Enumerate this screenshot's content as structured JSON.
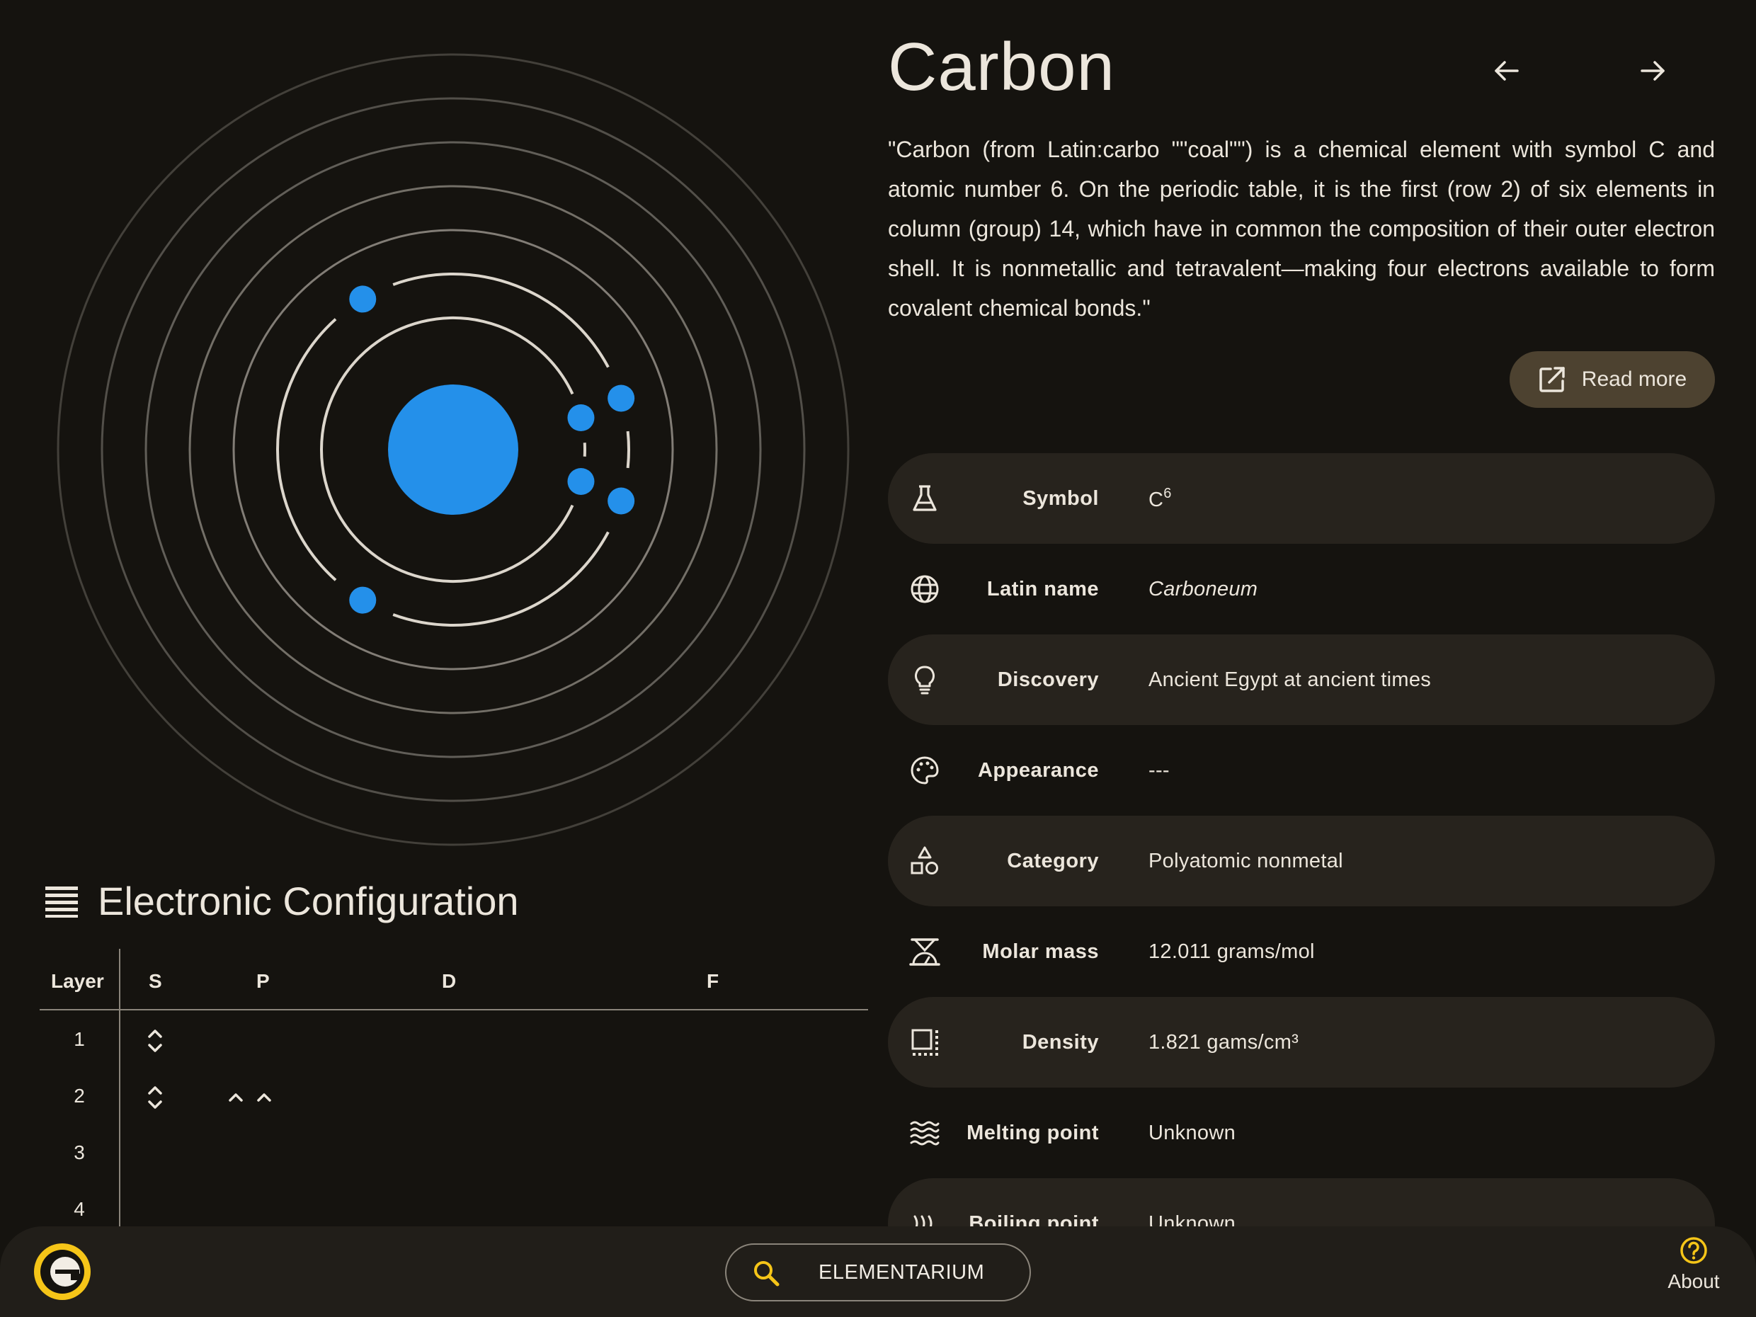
{
  "element": {
    "name": "Carbon",
    "description": "\"Carbon (from Latin:carbo \"\"coal\"\") is a chemical element with symbol C and atomic number 6. On the periodic table, it is the first (row 2) of six elements in column (group) 14, which have in common the composition of their outer electron shell. It is nonmetallic and tetravalent—making four electrons available to form covalent chemical bonds.\"",
    "read_more_label": "Read more"
  },
  "properties": [
    {
      "icon": "flask-icon",
      "label": "Symbol",
      "value": "C",
      "sup": "6",
      "shaded": true
    },
    {
      "icon": "globe-icon",
      "label": "Latin name",
      "value": "Carboneum",
      "italic": true,
      "shaded": false
    },
    {
      "icon": "lightbulb-icon",
      "label": "Discovery",
      "value": "Ancient Egypt at ancient times",
      "shaded": true
    },
    {
      "icon": "palette-icon",
      "label": "Appearance",
      "value": "---",
      "shaded": false
    },
    {
      "icon": "shapes-icon",
      "label": "Category",
      "value": "Polyatomic nonmetal",
      "shaded": true
    },
    {
      "icon": "scale-icon",
      "label": "Molar mass",
      "value": "12.011 grams/mol",
      "shaded": false
    },
    {
      "icon": "density-icon",
      "label": "Density",
      "value": "1.821 gams/cm³",
      "shaded": true
    },
    {
      "icon": "waves-icon",
      "label": "Melting point",
      "value": "Unknown",
      "shaded": false
    },
    {
      "icon": "heat-icon",
      "label": "Boiling point",
      "value": "Unknown",
      "shaded": true
    }
  ],
  "config": {
    "title": "Electronic Configuration",
    "headers": [
      "Layer",
      "S",
      "P",
      "D",
      "F"
    ],
    "layers": [
      {
        "num": "1",
        "s": [
          "paired"
        ],
        "p": []
      },
      {
        "num": "2",
        "s": [
          "paired"
        ],
        "p": [
          "up",
          "up"
        ]
      },
      {
        "num": "3",
        "s": [],
        "p": []
      },
      {
        "num": "4",
        "s": [],
        "p": []
      }
    ]
  },
  "atom": {
    "shells": [
      {
        "electrons": 2
      },
      {
        "electrons": 4
      }
    ],
    "empty_shells": 5,
    "colors": {
      "nucleus": "#2490ea",
      "electron": "#2490ea",
      "orbit": "#dcd6cc"
    }
  },
  "bottom_bar": {
    "search_text": "ELEMENTARIUM",
    "about_label": "About"
  },
  "colors": {
    "background": "#15130f",
    "accent": "#f5c518",
    "button": "#4d4230",
    "row_shade": "#27231d"
  }
}
